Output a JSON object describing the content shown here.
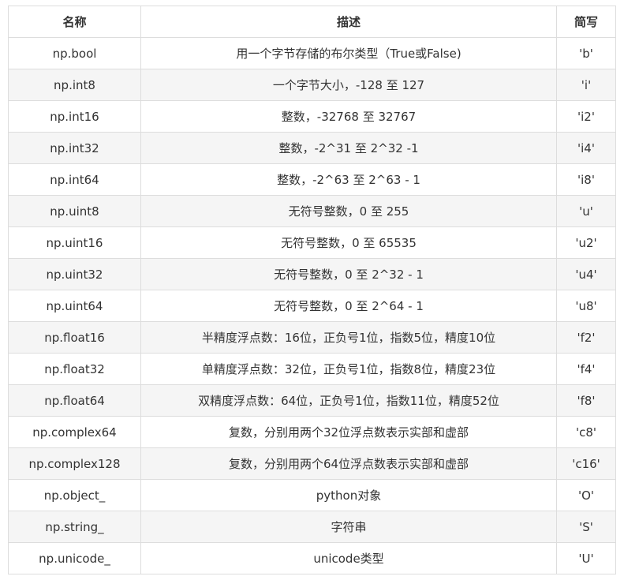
{
  "table": {
    "headers": {
      "name": "名称",
      "description": "描述",
      "abbr": "简写"
    },
    "rows": [
      {
        "name": "np.bool",
        "description": "用一个字节存储的布尔类型（True或False)",
        "abbr": "'b'"
      },
      {
        "name": "np.int8",
        "description": "一个字节大小，-128 至 127",
        "abbr": "'i'"
      },
      {
        "name": "np.int16",
        "description": "整数，-32768 至 32767",
        "abbr": "'i2'"
      },
      {
        "name": "np.int32",
        "description": "整数，-2^31 至 2^32 -1",
        "abbr": "'i4'"
      },
      {
        "name": "np.int64",
        "description": "整数，-2^63 至 2^63 - 1",
        "abbr": "'i8'"
      },
      {
        "name": "np.uint8",
        "description": "无符号整数，0 至 255",
        "abbr": "'u'"
      },
      {
        "name": "np.uint16",
        "description": "无符号整数，0 至 65535",
        "abbr": "'u2'"
      },
      {
        "name": "np.uint32",
        "description": "无符号整数，0 至 2^32 - 1",
        "abbr": "'u4'"
      },
      {
        "name": "np.uint64",
        "description": "无符号整数，0 至 2^64 - 1",
        "abbr": "'u8'"
      },
      {
        "name": "np.float16",
        "description": "半精度浮点数：16位，正负号1位，指数5位，精度10位",
        "abbr": "'f2'"
      },
      {
        "name": "np.float32",
        "description": "单精度浮点数：32位，正负号1位，指数8位，精度23位",
        "abbr": "'f4'"
      },
      {
        "name": "np.float64",
        "description": "双精度浮点数：64位，正负号1位，指数11位，精度52位",
        "abbr": "'f8'"
      },
      {
        "name": "np.complex64",
        "description": "复数，分别用两个32位浮点数表示实部和虚部",
        "abbr": "'c8'"
      },
      {
        "name": "np.complex128",
        "description": "复数，分别用两个64位浮点数表示实部和虚部",
        "abbr": "'c16'"
      },
      {
        "name": "np.object_",
        "description": "python对象",
        "abbr": "'O'"
      },
      {
        "name": "np.string_",
        "description": "字符串",
        "abbr": "'S'"
      },
      {
        "name": "np.unicode_",
        "description": "unicode类型",
        "abbr": "'U'"
      }
    ]
  }
}
